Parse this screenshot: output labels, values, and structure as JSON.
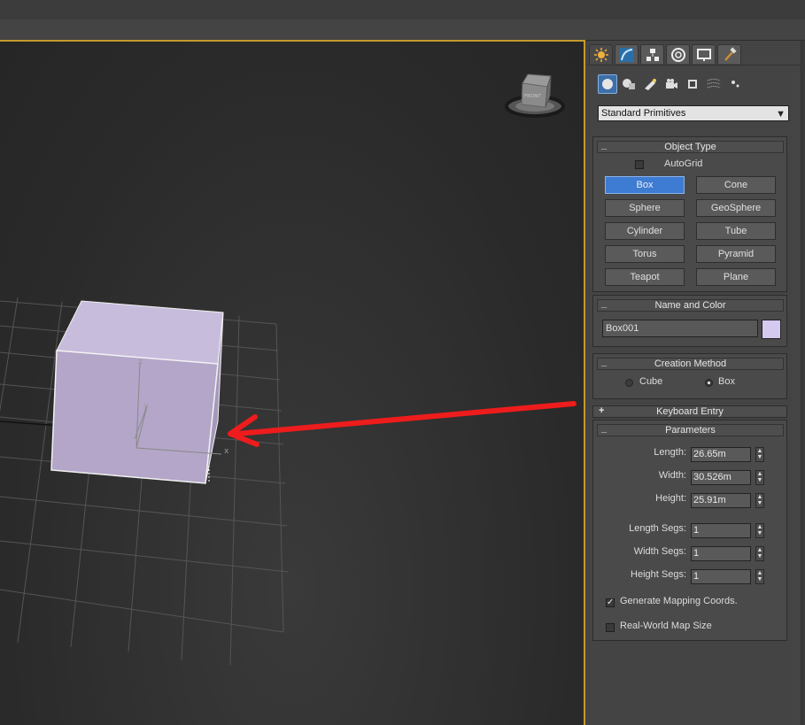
{
  "command_panel": {
    "tabs": [
      "create-tab",
      "modify-tab",
      "hierarchy-tab",
      "motion-tab",
      "display-tab",
      "utilities-tab"
    ],
    "subcategories": [
      "geometry",
      "shapes",
      "lights",
      "cameras",
      "helpers",
      "space-warps",
      "systems"
    ],
    "primitive_type": "Standard Primitives",
    "object_type": {
      "title": "Object Type",
      "autogrid_label": "AutoGrid",
      "autogrid_checked": false,
      "buttons": [
        "Box",
        "Cone",
        "Sphere",
        "GeoSphere",
        "Cylinder",
        "Tube",
        "Torus",
        "Pyramid",
        "Teapot",
        "Plane"
      ],
      "active": "Box"
    },
    "name_and_color": {
      "title": "Name and Color",
      "name": "Box001",
      "color": "#d6c9ef"
    },
    "creation_method": {
      "title": "Creation Method",
      "options": [
        "Cube",
        "Box"
      ],
      "selected": "Box"
    },
    "keyboard_entry": {
      "title": "Keyboard Entry",
      "sign": "+"
    },
    "parameters": {
      "title": "Parameters",
      "fields": [
        {
          "label": "Length:",
          "value": "26.65m"
        },
        {
          "label": "Width:",
          "value": "30.526m"
        },
        {
          "label": "Height:",
          "value": "25.91m"
        }
      ],
      "segments": [
        {
          "label": "Length Segs:",
          "value": "1"
        },
        {
          "label": "Width Segs:",
          "value": "1"
        },
        {
          "label": "Height Segs:",
          "value": "1"
        }
      ],
      "generate_mapping": {
        "label": "Generate Mapping Coords.",
        "checked": true
      },
      "real_world": {
        "label": "Real-World Map Size",
        "checked": false
      }
    },
    "collapse_sign": "_"
  },
  "viewport": {
    "viewcube_label": "FRONT",
    "axes": {
      "x": "x",
      "y": "y",
      "z": "z"
    },
    "annotation_color": "#ee1c1c",
    "box_color": "#c4b6d8"
  }
}
